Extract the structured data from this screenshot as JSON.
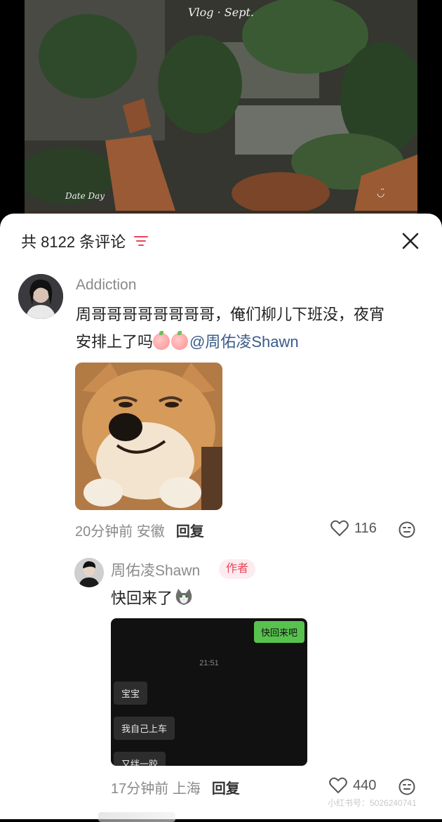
{
  "video": {
    "title": "Vlog · Sept.",
    "caption": "Date Day"
  },
  "comments_header": {
    "count_label": "共 8122 条评论"
  },
  "comment1": {
    "username": "Addiction",
    "text_line1": "周哥哥哥哥哥哥哥哥，俺们柳儿下班没，夜宵",
    "text_line2": "安排上了吗",
    "mention": "@周佑凌Shawn",
    "time_location": "20分钟前 安徽",
    "reply_label": "回复",
    "likes": "116"
  },
  "reply1": {
    "username": "周佑凌Shawn",
    "badge": "作者",
    "text": "快回来了",
    "chat": {
      "green_bubble": "快回来吧",
      "time": "21:51",
      "bubbles": [
        "宝宝",
        "我自己上车",
        "又绊一跤"
      ]
    },
    "time_location": "17分钟前 上海",
    "reply_label": "回复",
    "likes": "440"
  },
  "watermark": "小红书号：5026240741"
}
